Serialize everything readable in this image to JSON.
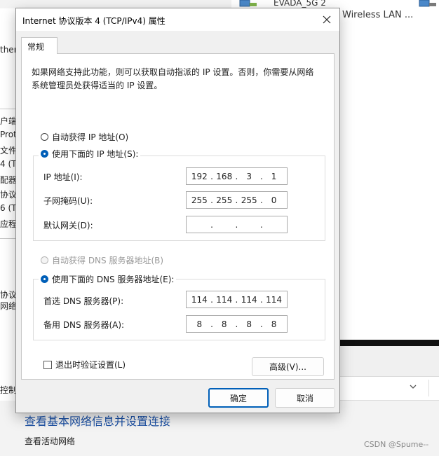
{
  "dialog": {
    "title": "Internet 协议版本 4 (TCP/IPv4) 属性",
    "tab": "常规",
    "description": "如果网络支持此功能，则可以获取自动指派的 IP 设置。否则，你需要从网络系统管理员处获得适当的 IP 设置。",
    "ip_section": {
      "auto_label": "自动获得 IP 地址(O)",
      "manual_label": "使用下面的 IP 地址(S):",
      "selected": "manual",
      "fields": [
        {
          "label": "IP 地址(I):",
          "octets": [
            "192",
            "168",
            "3",
            "1"
          ]
        },
        {
          "label": "子网掩码(U):",
          "octets": [
            "255",
            "255",
            "255",
            "0"
          ]
        },
        {
          "label": "默认网关(D):",
          "octets": [
            "",
            "",
            "",
            ""
          ]
        }
      ]
    },
    "dns_section": {
      "auto_label": "自动获得 DNS 服务器地址(B)",
      "manual_label": "使用下面的 DNS 服务器地址(E):",
      "selected": "manual",
      "fields": [
        {
          "label": "首选 DNS 服务器(P):",
          "octets": [
            "114",
            "114",
            "114",
            "114"
          ]
        },
        {
          "label": "备用 DNS 服务器(A):",
          "octets": [
            "8",
            "8",
            "8",
            "8"
          ]
        }
      ]
    },
    "validate_label": "退出时验证设置(L)",
    "validate_checked": false,
    "advanced_label": "高级(V)...",
    "ok_label": "确定",
    "cancel_label": "取消"
  },
  "background": {
    "network_1": "EVADA_5G 2",
    "network_2": "Wireless LAN ...",
    "left_fragments": [
      "therı",
      "户端",
      "Prot",
      "文件",
      "4 (T",
      "配器",
      "协议",
      "6 (T",
      "应程",
      "协议",
      "网络,",
      "控制"
    ],
    "control_panel_heading": "查看基本网络信息并设置连接",
    "control_panel_sub": "查看活动网络",
    "watermark": "CSDN @Spume--"
  },
  "colors": {
    "accent": "#005fb8",
    "link": "#1a4fa3"
  },
  "icons": {
    "close": "close-icon",
    "network": "network-adapter-icon",
    "search_chevron": "chevron-down-icon"
  }
}
